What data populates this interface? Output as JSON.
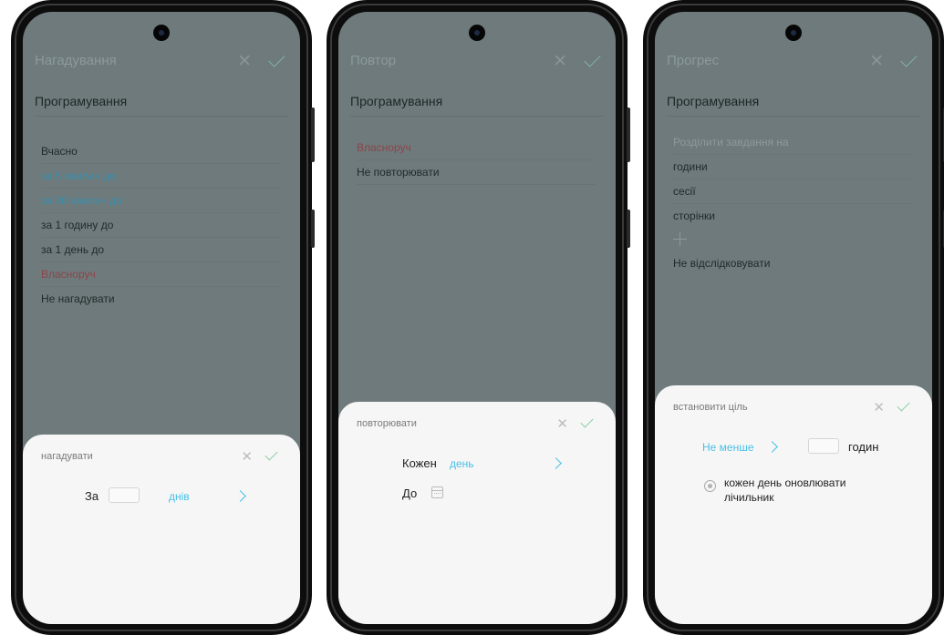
{
  "screens": [
    {
      "header_title": "Нагадування",
      "section": "Програмування",
      "items": [
        {
          "label": "Вчасно"
        },
        {
          "label": "за 5 хвилин до"
        },
        {
          "label": "за 30 хвилин до"
        },
        {
          "label": "за 1 годину до"
        },
        {
          "label": "за 1 день до"
        },
        {
          "label": "Власноруч"
        },
        {
          "label": "Не нагадувати"
        }
      ],
      "sheet": {
        "title": "нагадувати",
        "prefix": "За",
        "unit": "днів"
      }
    },
    {
      "header_title": "Повтор",
      "section": "Програмування",
      "items": [
        {
          "label": "Власноруч"
        },
        {
          "label": "Не повторювати"
        }
      ],
      "sheet": {
        "title": "повторювати",
        "every": "Кожен",
        "period": "день",
        "until": "До"
      }
    },
    {
      "header_title": "Прогрес",
      "section": "Програмування",
      "items": [
        {
          "label": "Розділити завдання на"
        },
        {
          "label": "години"
        },
        {
          "label": "сесії"
        },
        {
          "label": "сторінки"
        },
        {
          "label": "Не відслідковувати"
        }
      ],
      "sheet": {
        "title": "встановити ціль",
        "min": "Не менше",
        "unit": "годин",
        "option_line1": "кожен день оновлювати",
        "option_line2": "лічильник"
      }
    }
  ]
}
